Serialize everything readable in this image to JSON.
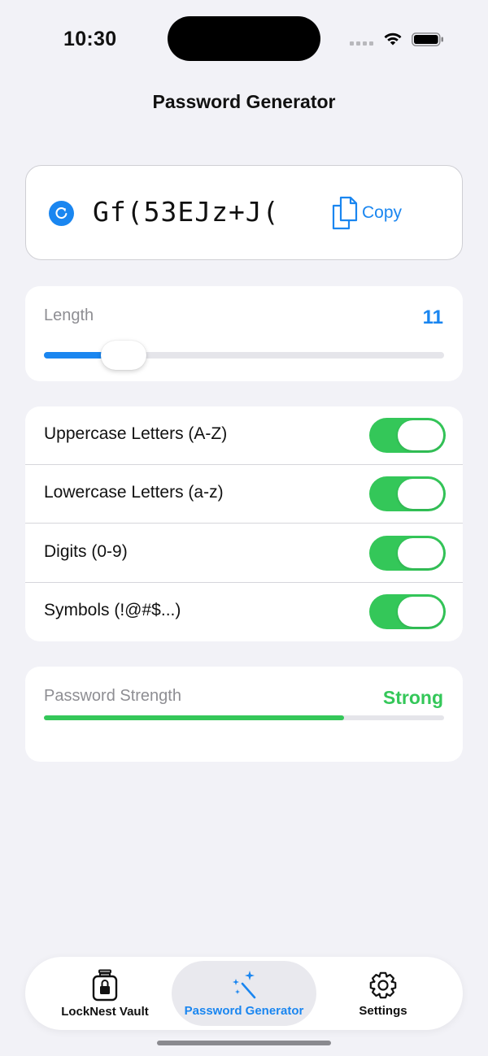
{
  "status_bar": {
    "time": "10:30"
  },
  "nav": {
    "title": "Password Generator"
  },
  "password": {
    "value": "Gf(53EJz+J(",
    "refresh_icon": "refresh-icon",
    "copy_label": "Copy",
    "copy_icon": "document-copy-icon"
  },
  "length": {
    "label": "Length",
    "value": "11",
    "slider_fraction": 0.2
  },
  "options": [
    {
      "label": "Uppercase Letters (A-Z)",
      "on": true
    },
    {
      "label": "Lowercase Letters (a-z)",
      "on": true
    },
    {
      "label": "Digits (0-9)",
      "on": true
    },
    {
      "label": "Symbols (!@#$...)",
      "on": true
    }
  ],
  "strength": {
    "label": "Password Strength",
    "value": "Strong",
    "fraction": 0.75
  },
  "tabs": [
    {
      "label": "LockNest Vault",
      "icon": "lock-jar-icon",
      "selected": false
    },
    {
      "label": "Password Generator",
      "icon": "magic-wand-icon",
      "selected": true
    },
    {
      "label": "Settings",
      "icon": "gear-icon",
      "selected": false
    }
  ],
  "colors": {
    "accent": "#1a86f0",
    "toggle_on": "#34c759",
    "strength": "#34c759",
    "background": "#f2f2f7"
  }
}
